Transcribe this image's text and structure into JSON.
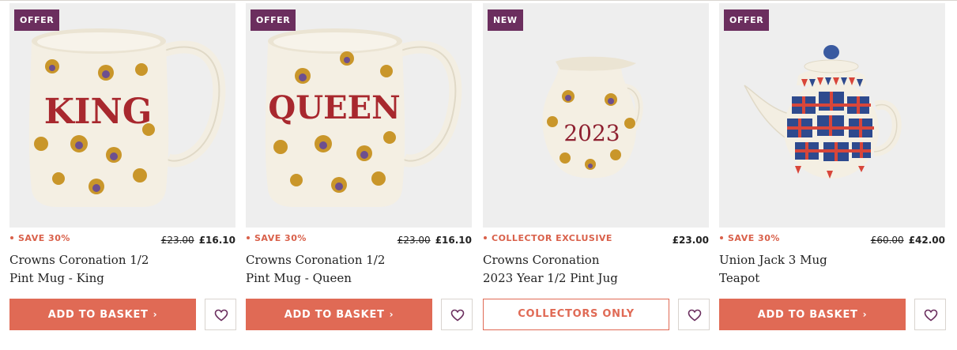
{
  "products": [
    {
      "badge": "OFFER",
      "promo": "SAVE 30%",
      "was_price": "£23.00",
      "price": "£16.10",
      "title_line1": "Crowns Coronation 1/2",
      "title_line2": "Pint Mug - King",
      "button_label": "ADD TO BASKET",
      "mug_text": "KING"
    },
    {
      "badge": "OFFER",
      "promo": "SAVE 30%",
      "was_price": "£23.00",
      "price": "£16.10",
      "title_line1": "Crowns Coronation 1/2",
      "title_line2": "Pint Mug - Queen",
      "button_label": "ADD TO BASKET",
      "mug_text": "QUEEN"
    },
    {
      "badge": "NEW",
      "promo": "COLLECTOR EXCLUSIVE",
      "was_price": "",
      "price": "£23.00",
      "title_line1": "Crowns Coronation",
      "title_line2": "2023 Year 1/2 Pint Jug",
      "button_label": "COLLECTORS ONLY",
      "jug_text": "2023"
    },
    {
      "badge": "OFFER",
      "promo": "SAVE 30%",
      "was_price": "£60.00",
      "price": "£42.00",
      "title_line1": "Union Jack 3 Mug",
      "title_line2": "Teapot",
      "button_label": "ADD TO BASKET"
    }
  ],
  "icons": {
    "chevron": "chevron-right-icon",
    "wishlist": "heart-icon"
  },
  "colors": {
    "badge": "#6b2e5e",
    "accent": "#e06a55",
    "promo": "#d9604a",
    "photo_bg": "#eeeeee"
  }
}
